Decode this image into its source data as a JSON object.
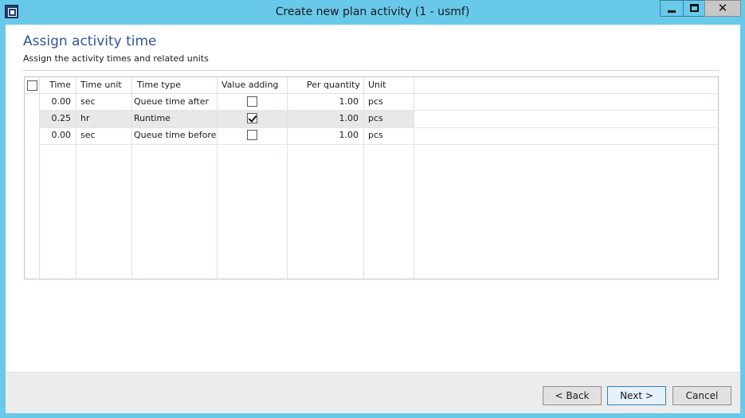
{
  "window": {
    "title": "Create new plan activity (1 - usmf)",
    "close_glyph": "✕"
  },
  "page": {
    "heading": "Assign activity time",
    "subheading": "Assign the activity times and related units"
  },
  "grid": {
    "columns": [
      "Time",
      "Time unit",
      "Time type",
      "Value adding",
      "Per quantity",
      "Unit"
    ],
    "rows": [
      {
        "time": "0.00",
        "time_unit": "sec",
        "time_type": "Queue time after",
        "value_adding": false,
        "per_quantity": "1.00",
        "unit": "pcs"
      },
      {
        "time": "0.25",
        "time_unit": "hr",
        "time_type": "Runtime",
        "value_adding": true,
        "per_quantity": "1.00",
        "unit": "pcs",
        "selected": true
      },
      {
        "time": "0.00",
        "time_unit": "sec",
        "time_type": "Queue time before",
        "value_adding": false,
        "per_quantity": "1.00",
        "unit": "pcs"
      }
    ]
  },
  "footer": {
    "back_label": "< Back",
    "next_label": "Next >",
    "cancel_label": "Cancel"
  },
  "colors": {
    "window_frame": "#69c9ea",
    "heading": "#2f5597",
    "selected_row": "#e8e8e8"
  }
}
